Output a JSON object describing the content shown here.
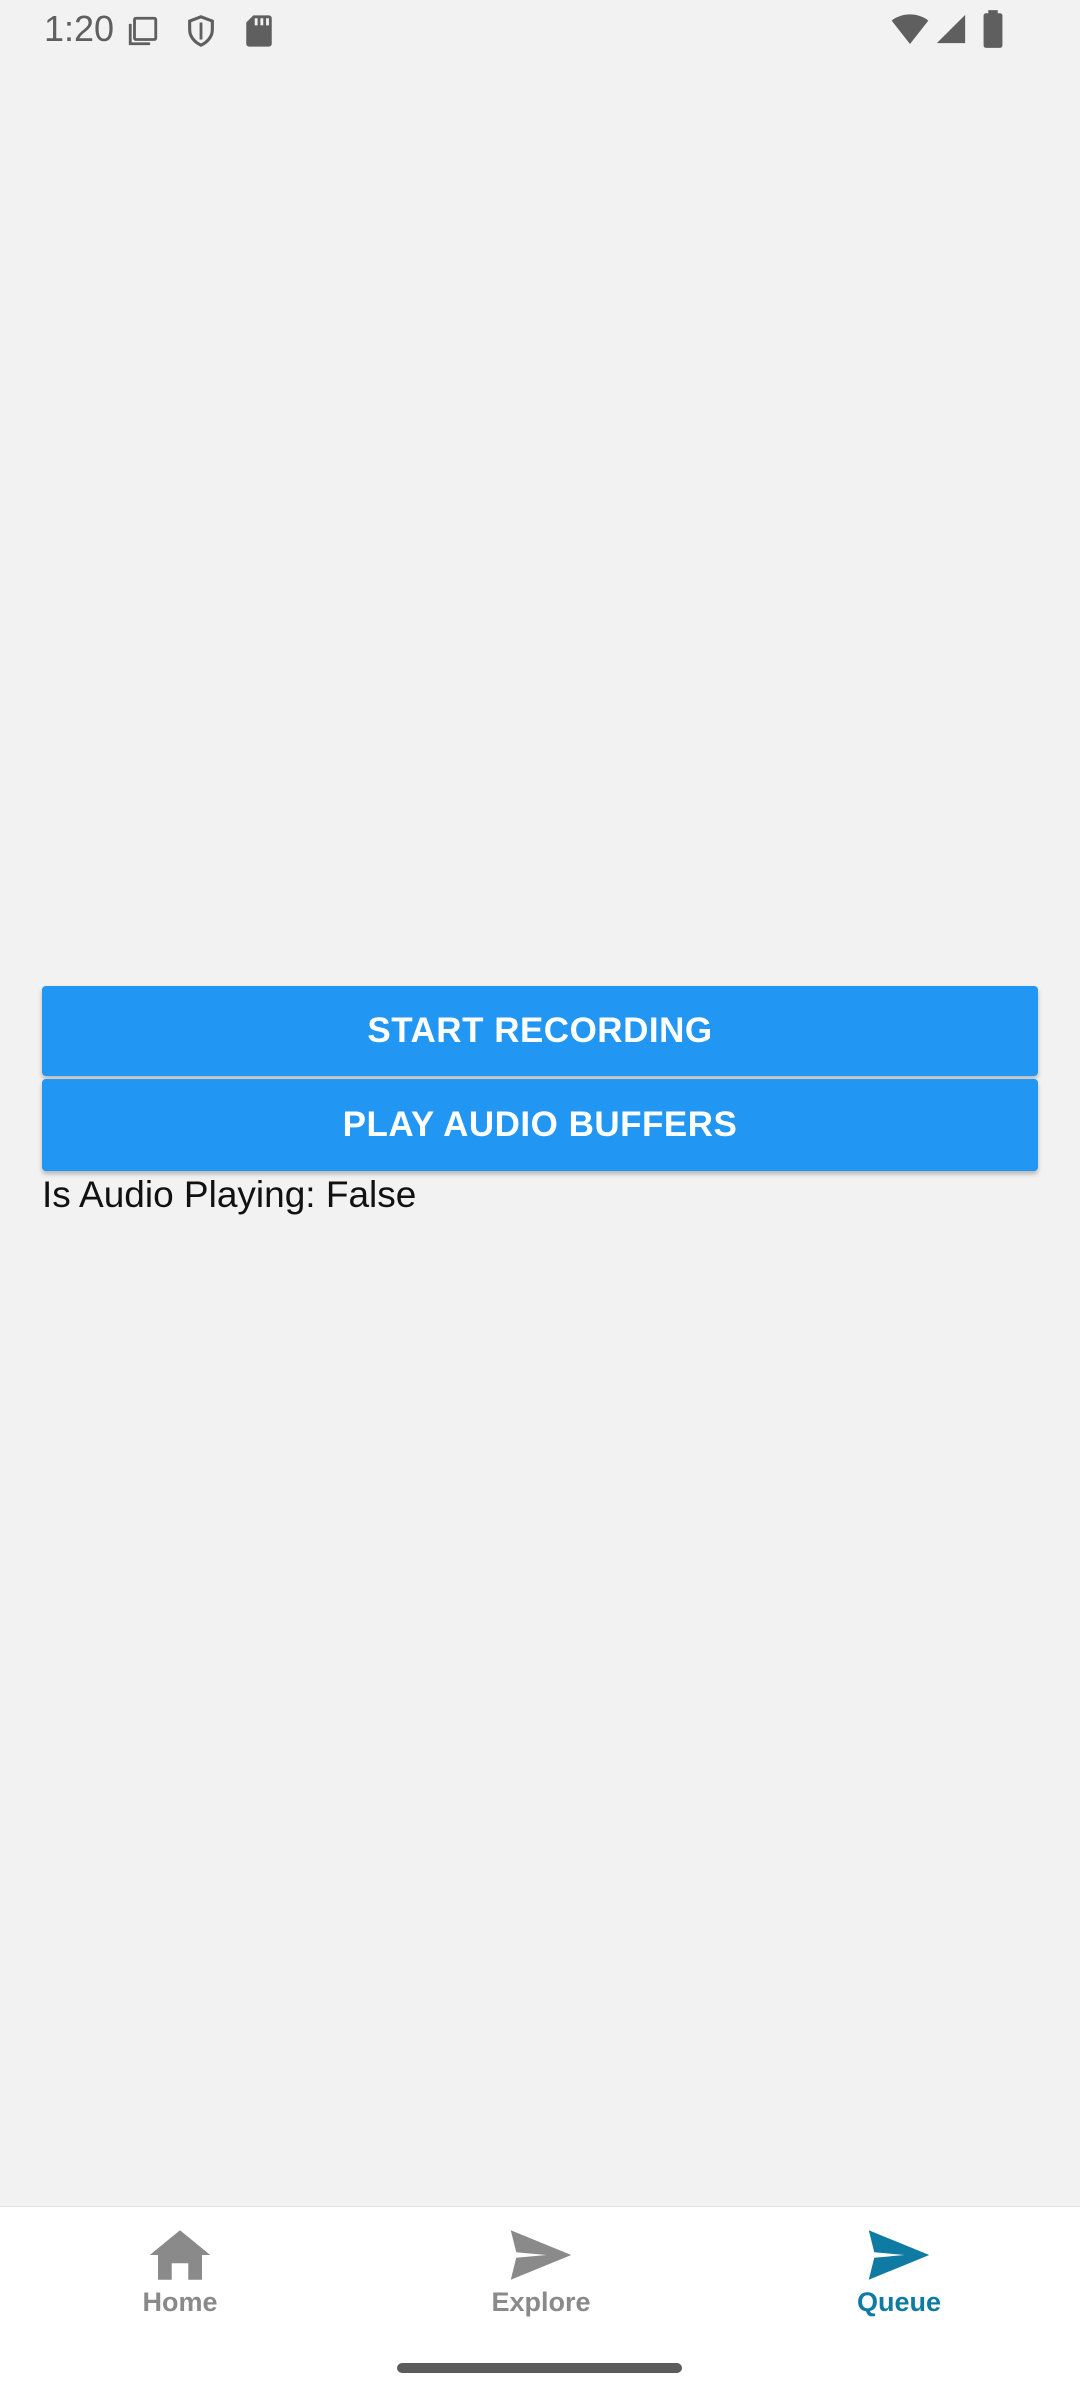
{
  "status_bar": {
    "time": "1:20",
    "icons": [
      "screenshot-icon",
      "shield-icon",
      "sd-card-icon",
      "wifi-icon",
      "signal-icon",
      "battery-icon"
    ]
  },
  "main": {
    "start_recording_label": "START RECORDING",
    "play_audio_label": "PLAY AUDIO BUFFERS",
    "audio_status_text": "Is Audio Playing: False"
  },
  "bottom_nav": {
    "items": [
      {
        "label": "Home",
        "icon": "home-icon",
        "active": false
      },
      {
        "label": "Explore",
        "icon": "send-icon",
        "active": false
      },
      {
        "label": "Queue",
        "icon": "send-icon",
        "active": true
      }
    ]
  },
  "colors": {
    "button": "#2196f3",
    "active_tab": "#0f7ba3",
    "inactive_tab": "#8a8a8a",
    "background": "#f2f2f2"
  }
}
